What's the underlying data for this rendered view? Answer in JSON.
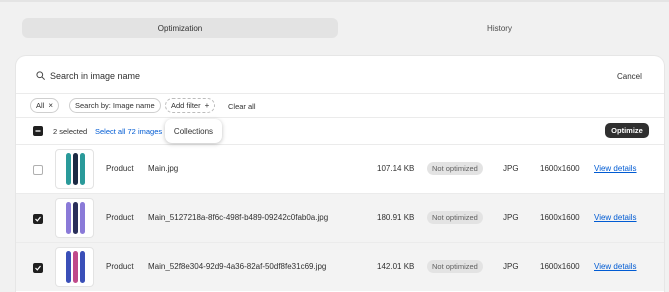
{
  "tabs": [
    {
      "label": "Optimization",
      "active": true
    },
    {
      "label": "History",
      "active": false
    }
  ],
  "search": {
    "placeholder": "Search in image name",
    "cancel_label": "Cancel",
    "icon": "search-icon"
  },
  "filters": {
    "chips": [
      {
        "label": "All"
      },
      {
        "label": "Search by: Image name"
      }
    ],
    "add_filter_label": "Add filter",
    "clear_all_label": "Clear all"
  },
  "bulk": {
    "selected_text": "2 selected",
    "select_all_text": "Select all 72 images",
    "optimize_label": "Optimize"
  },
  "popover": {
    "label": "Collections"
  },
  "rows": [
    {
      "type": "Product",
      "name": "Main.jpg",
      "size": "107.14 KB",
      "status": "Not optimized",
      "format": "JPG",
      "dimensions": "1600x1600",
      "action": "View details",
      "checked": false,
      "colors": [
        "#2a9a9a",
        "#1c2a44"
      ]
    },
    {
      "type": "Product",
      "name": "Main_5127218a-8f6c-498f-b489-09242c0fab0a.jpg",
      "size": "180.91 KB",
      "status": "Not optimized",
      "format": "JPG",
      "dimensions": "1600x1600",
      "action": "View details",
      "checked": true,
      "colors": [
        "#8a7ad8",
        "#2a2f5a"
      ]
    },
    {
      "type": "Product",
      "name": "Main_52f8e304-92d9-4a36-82af-50df8fe31c69.jpg",
      "size": "142.01 KB",
      "status": "Not optimized",
      "format": "JPG",
      "dimensions": "1600x1600",
      "action": "View details",
      "checked": true,
      "colors": [
        "#3a4fb8",
        "#c04a8a"
      ]
    }
  ],
  "colors": {
    "accent_link": "#005bd3",
    "primary_button": "#303030",
    "badge_bg": "#e3e3e3"
  }
}
